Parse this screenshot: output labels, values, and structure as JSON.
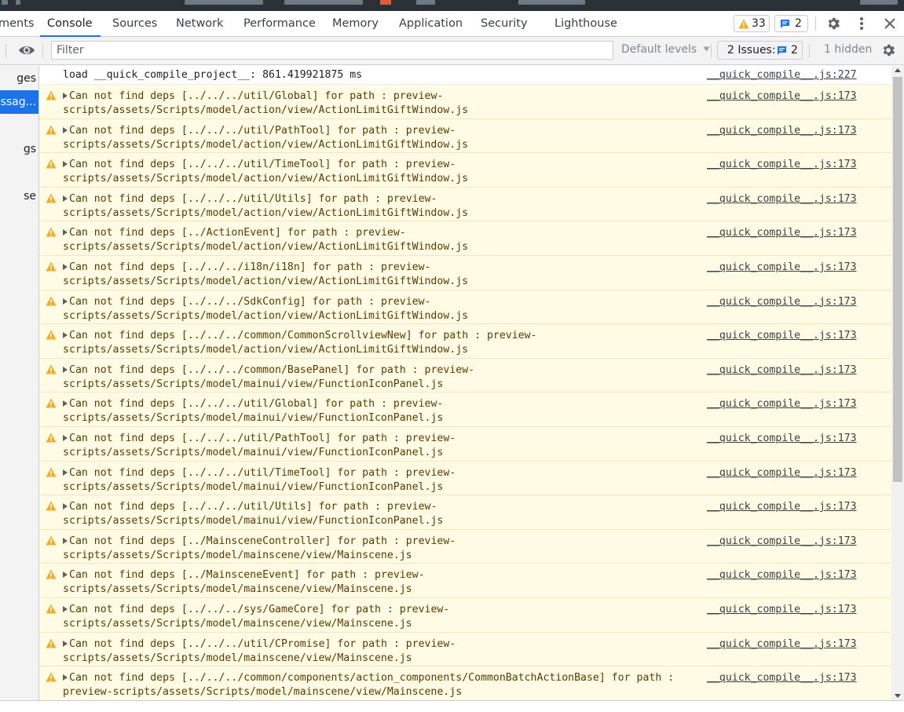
{
  "tabs": [
    {
      "label": "ments"
    },
    {
      "label": "Console"
    },
    {
      "label": "Sources"
    },
    {
      "label": "Network"
    },
    {
      "label": "Performance"
    },
    {
      "label": "Memory"
    },
    {
      "label": "Application"
    },
    {
      "label": "Security"
    },
    {
      "label": "Lighthouse"
    }
  ],
  "toolbar": {
    "warnings_count": "33",
    "messages_count": "2"
  },
  "filter": {
    "placeholder": "Filter",
    "value": ""
  },
  "levels": {
    "label": "Default levels"
  },
  "issues": {
    "label": "2 Issues:",
    "count": "2"
  },
  "hidden": {
    "label": "1 hidden"
  },
  "sidebar": {
    "items": [
      {
        "label": "ges"
      },
      {
        "label": "essag..."
      },
      {
        "label": "gs"
      },
      {
        "label": "se"
      }
    ]
  },
  "colors": {
    "accent": "#1a73e8",
    "warning_background": "#fffbe5",
    "warning_text": "#5c3b00",
    "warning_icon": "#f2ab26"
  },
  "console": {
    "info": {
      "message": "load __quick_compile_project__: 861.419921875 ms",
      "source": "__quick_compile__.js:227"
    },
    "warnings": [
      {
        "line1": "Can not find deps [../../../util/Global] for path : preview-",
        "line2": "scripts/assets/Scripts/model/action/view/ActionLimitGiftWindow.js",
        "source": "__quick_compile__.js:173"
      },
      {
        "line1": "Can not find deps [../../../util/PathTool] for path : preview-",
        "line2": "scripts/assets/Scripts/model/action/view/ActionLimitGiftWindow.js",
        "source": "__quick_compile__.js:173"
      },
      {
        "line1": "Can not find deps [../../../util/TimeTool] for path : preview-",
        "line2": "scripts/assets/Scripts/model/action/view/ActionLimitGiftWindow.js",
        "source": "__quick_compile__.js:173"
      },
      {
        "line1": "Can not find deps [../../../util/Utils] for path : preview-",
        "line2": "scripts/assets/Scripts/model/action/view/ActionLimitGiftWindow.js",
        "source": "__quick_compile__.js:173"
      },
      {
        "line1": "Can not find deps [../ActionEvent] for path : preview-",
        "line2": "scripts/assets/Scripts/model/action/view/ActionLimitGiftWindow.js",
        "source": "__quick_compile__.js:173"
      },
      {
        "line1": "Can not find deps [../../../i18n/i18n] for path : preview-",
        "line2": "scripts/assets/Scripts/model/action/view/ActionLimitGiftWindow.js",
        "source": "__quick_compile__.js:173"
      },
      {
        "line1": "Can not find deps [../../../SdkConfig] for path : preview-",
        "line2": "scripts/assets/Scripts/model/action/view/ActionLimitGiftWindow.js",
        "source": "__quick_compile__.js:173"
      },
      {
        "line1": "Can not find deps [../../../common/CommonScrollviewNew] for path : preview-",
        "line2": "scripts/assets/Scripts/model/action/view/ActionLimitGiftWindow.js",
        "source": "__quick_compile__.js:173"
      },
      {
        "line1": "Can not find deps [../../../common/BasePanel] for path : preview-",
        "line2": "scripts/assets/Scripts/model/mainui/view/FunctionIconPanel.js",
        "source": "__quick_compile__.js:173"
      },
      {
        "line1": "Can not find deps [../../../util/Global] for path : preview-",
        "line2": "scripts/assets/Scripts/model/mainui/view/FunctionIconPanel.js",
        "source": "__quick_compile__.js:173"
      },
      {
        "line1": "Can not find deps [../../../util/PathTool] for path : preview-",
        "line2": "scripts/assets/Scripts/model/mainui/view/FunctionIconPanel.js",
        "source": "__quick_compile__.js:173"
      },
      {
        "line1": "Can not find deps [../../../util/TimeTool] for path : preview-",
        "line2": "scripts/assets/Scripts/model/mainui/view/FunctionIconPanel.js",
        "source": "__quick_compile__.js:173"
      },
      {
        "line1": "Can not find deps [../../../util/Utils] for path : preview-",
        "line2": "scripts/assets/Scripts/model/mainui/view/FunctionIconPanel.js",
        "source": "__quick_compile__.js:173"
      },
      {
        "line1": "Can not find deps [../MainsceneController] for path : preview-",
        "line2": "scripts/assets/Scripts/model/mainscene/view/Mainscene.js",
        "source": "__quick_compile__.js:173"
      },
      {
        "line1": "Can not find deps [../MainsceneEvent] for path : preview-",
        "line2": "scripts/assets/Scripts/model/mainscene/view/Mainscene.js",
        "source": "__quick_compile__.js:173"
      },
      {
        "line1": "Can not find deps [../../../sys/GameCore] for path : preview-",
        "line2": "scripts/assets/Scripts/model/mainscene/view/Mainscene.js",
        "source": "__quick_compile__.js:173"
      },
      {
        "line1": "Can not find deps [../../../util/CPromise] for path : preview-",
        "line2": "scripts/assets/Scripts/model/mainscene/view/Mainscene.js",
        "source": "__quick_compile__.js:173"
      },
      {
        "line1": "Can not find deps [../../../common/components/action_components/CommonBatchActionBase] for path :",
        "line2": "preview-scripts/assets/Scripts/model/mainscene/view/Mainscene.js",
        "source": "__quick_compile__.js:173"
      }
    ]
  }
}
